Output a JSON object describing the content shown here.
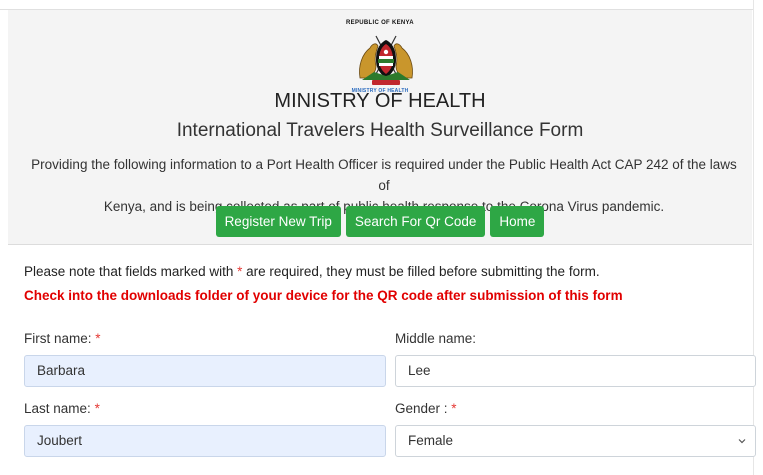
{
  "header": {
    "republic": "REPUBLIC OF KENYA",
    "ministry_small": "MINISTRY OF HEALTH",
    "ministry": "MINISTRY OF HEALTH",
    "form_title": "International Travelers Health Surveillance Form",
    "description_line1": "Providing the following information to a Port Health Officer is required under the Public Health Act CAP 242 of the laws of",
    "description_line2": "Kenya, and is being collected as part of public health response to the Corona Virus pandemic.",
    "buttons": {
      "register": "Register New Trip",
      "search": "Search For Qr Code",
      "home": "Home"
    }
  },
  "notice": {
    "part1": "Please note that fields marked with ",
    "asterisk": "*",
    "part2": " are required, they must be filled before submitting the form.",
    "download_note": "Check into the downloads folder of your device for the QR code after submission of this form"
  },
  "form": {
    "first_name": {
      "label": "First name:",
      "required": "*",
      "value": "Barbara"
    },
    "middle_name": {
      "label": "Middle name:",
      "value": "Lee"
    },
    "last_name": {
      "label": "Last name:",
      "required": "*",
      "value": "Joubert"
    },
    "gender": {
      "label": "Gender :",
      "required": "*",
      "value": "Female"
    }
  },
  "icons": {
    "crest": "kenya-coat-of-arms-icon",
    "select_arrow": "chevron-down-icon"
  },
  "colors": {
    "button_green": "#2ea745",
    "required_red": "#e53935",
    "note_red": "#e10000",
    "autofill_blue": "#e8f0fe",
    "header_bg": "#f4f4f4"
  }
}
